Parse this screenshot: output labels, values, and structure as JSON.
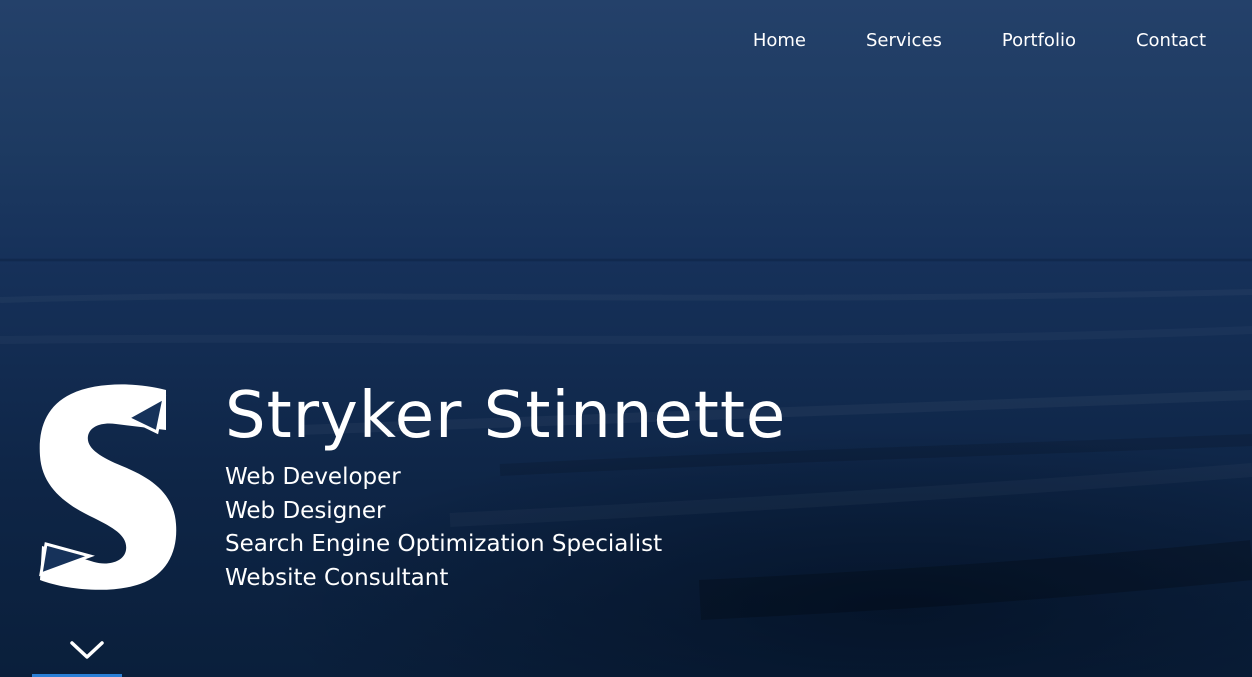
{
  "nav": {
    "items": [
      {
        "label": "Home"
      },
      {
        "label": "Services"
      },
      {
        "label": "Portfolio"
      },
      {
        "label": "Contact"
      }
    ]
  },
  "hero": {
    "logo_icon": "stylized-s-logo-icon",
    "name": "Stryker Stinnette",
    "roles": [
      "Web Developer",
      "Web Designer",
      "Search Engine Optimization Specialist",
      "Website Consultant"
    ],
    "scroll_icon": "chevron-down-icon"
  },
  "colors": {
    "background_top": "#24416a",
    "background_bottom": "#0a1f3b",
    "text": "#ffffff",
    "accent": "#2a7fd6"
  }
}
